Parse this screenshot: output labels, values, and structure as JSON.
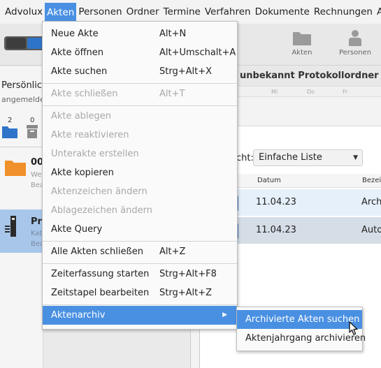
{
  "menubar": {
    "items": [
      "Advolux",
      "Akten",
      "Personen",
      "Ordner",
      "Termine",
      "Verfahren",
      "Dokumente",
      "Rechnungen",
      "Auswe"
    ],
    "active_index": 1
  },
  "toolbar": {
    "akten_label": "Akten",
    "personen_label": "Personen"
  },
  "left_panel": {
    "title": "Persönlich",
    "subtitle": "angemelde",
    "count_a": "2",
    "count_b": "0",
    "item1": {
      "title": "00",
      "sub1": "We",
      "sub2": "Bea"
    },
    "item2": {
      "title": "Pro",
      "sub1": "Kat",
      "sub2": "Bea"
    }
  },
  "calendar": {
    "header": "unbekannt Protokollordner Akten",
    "days": [
      "Mi",
      "Do",
      "Fr"
    ]
  },
  "list_view": {
    "view_label": "cht:",
    "select_value": "Einfache Liste",
    "columns": [
      "Datum",
      "Bezei"
    ],
    "rows": [
      {
        "datum": "11.04.23",
        "bezeichnung": "Arch"
      },
      {
        "datum": "11.04.23",
        "bezeichnung": "Auto"
      }
    ]
  },
  "akten_menu": {
    "items": [
      {
        "label": "Neue Akte",
        "shortcut": "Alt+N",
        "enabled": true
      },
      {
        "label": "Akte öffnen",
        "shortcut": "Alt+Umschalt+A",
        "enabled": true
      },
      {
        "label": "Akte suchen",
        "shortcut": "Strg+Alt+X",
        "enabled": true
      },
      {
        "label": "Akte schließen",
        "shortcut": "Alt+T",
        "enabled": false
      },
      {
        "label": "Akte ablegen",
        "shortcut": "",
        "enabled": false
      },
      {
        "label": "Akte reaktivieren",
        "shortcut": "",
        "enabled": false
      },
      {
        "label": "Unterakte erstellen",
        "shortcut": "",
        "enabled": false
      },
      {
        "label": "Akte kopieren",
        "shortcut": "",
        "enabled": true
      },
      {
        "label": "Aktenzeichen ändern",
        "shortcut": "",
        "enabled": false
      },
      {
        "label": "Ablagezeichen ändern",
        "shortcut": "",
        "enabled": false
      },
      {
        "label": "Akte Query",
        "shortcut": "",
        "enabled": true
      },
      {
        "label": "Alle Akten schließen",
        "shortcut": "Alt+Z",
        "enabled": true
      },
      {
        "label": "Zeiterfassung starten",
        "shortcut": "Strg+Alt+F8",
        "enabled": true
      },
      {
        "label": "Zeitstapel bearbeiten",
        "shortcut": "Strg+Alt+Z",
        "enabled": true
      },
      {
        "label": "Aktenarchiv",
        "shortcut": "",
        "enabled": true,
        "submenu": true
      }
    ]
  },
  "archiv_submenu": {
    "items": [
      "Archivierte Akten suchen",
      "Aktenjahrgang archivieren"
    ]
  },
  "colors": {
    "accent": "#4a90e2",
    "disabled_text": "#a8a8a8",
    "folder_orange": "#f0902a",
    "folder_blue": "#2f74c8",
    "selected_row": "#a8c6ea"
  }
}
